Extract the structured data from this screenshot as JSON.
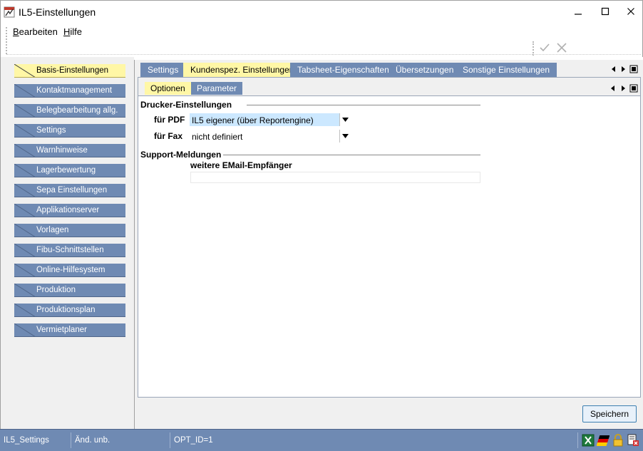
{
  "window": {
    "title": "IL5-Einstellungen"
  },
  "menu": {
    "bearbeiten_initial": "B",
    "bearbeiten_rest": "earbeiten",
    "hilfe_initial": "H",
    "hilfe_rest": "ilfe"
  },
  "nav": {
    "items": [
      "Basis-Einstellungen",
      "Kontaktmanagement",
      "Belegbearbeitung allg.",
      "Settings",
      "Warnhinweise",
      "Lagerbewertung",
      "Sepa Einstellungen",
      "Applikationserver",
      "Vorlagen",
      "Fibu-Schnittstellen",
      "Online-Hilfesystem",
      "Produktion",
      "Produktionsplan",
      "Vermietplaner"
    ],
    "active_index": 0
  },
  "tabs": [
    "Settings",
    "Kundenspez. Einstellungen",
    "Tabsheet-Eigenschaften",
    "Übersetzungen",
    "Sonstige Einstellungen"
  ],
  "subtabs": [
    "Optionen",
    "Parameter"
  ],
  "form": {
    "printer_section": "Drucker-Einstellungen",
    "pdf_label": "für PDF",
    "pdf_value": "IL5 eigener (über Reportengine)",
    "fax_label": "für Fax",
    "fax_value": "nicht definiert",
    "support_section": "Support-Meldungen",
    "email_label": "weitere EMail-Empfänger",
    "email_value": ""
  },
  "buttons": {
    "save": "Speichern"
  },
  "status": {
    "module": "IL5_Settings",
    "state": "Änd. unb.",
    "opt_id": "OPT_ID=1"
  },
  "colors": {
    "nav_blue": "#6f8ab3",
    "active_yellow": "#fff7a6",
    "selection_blue": "#cce8ff"
  }
}
